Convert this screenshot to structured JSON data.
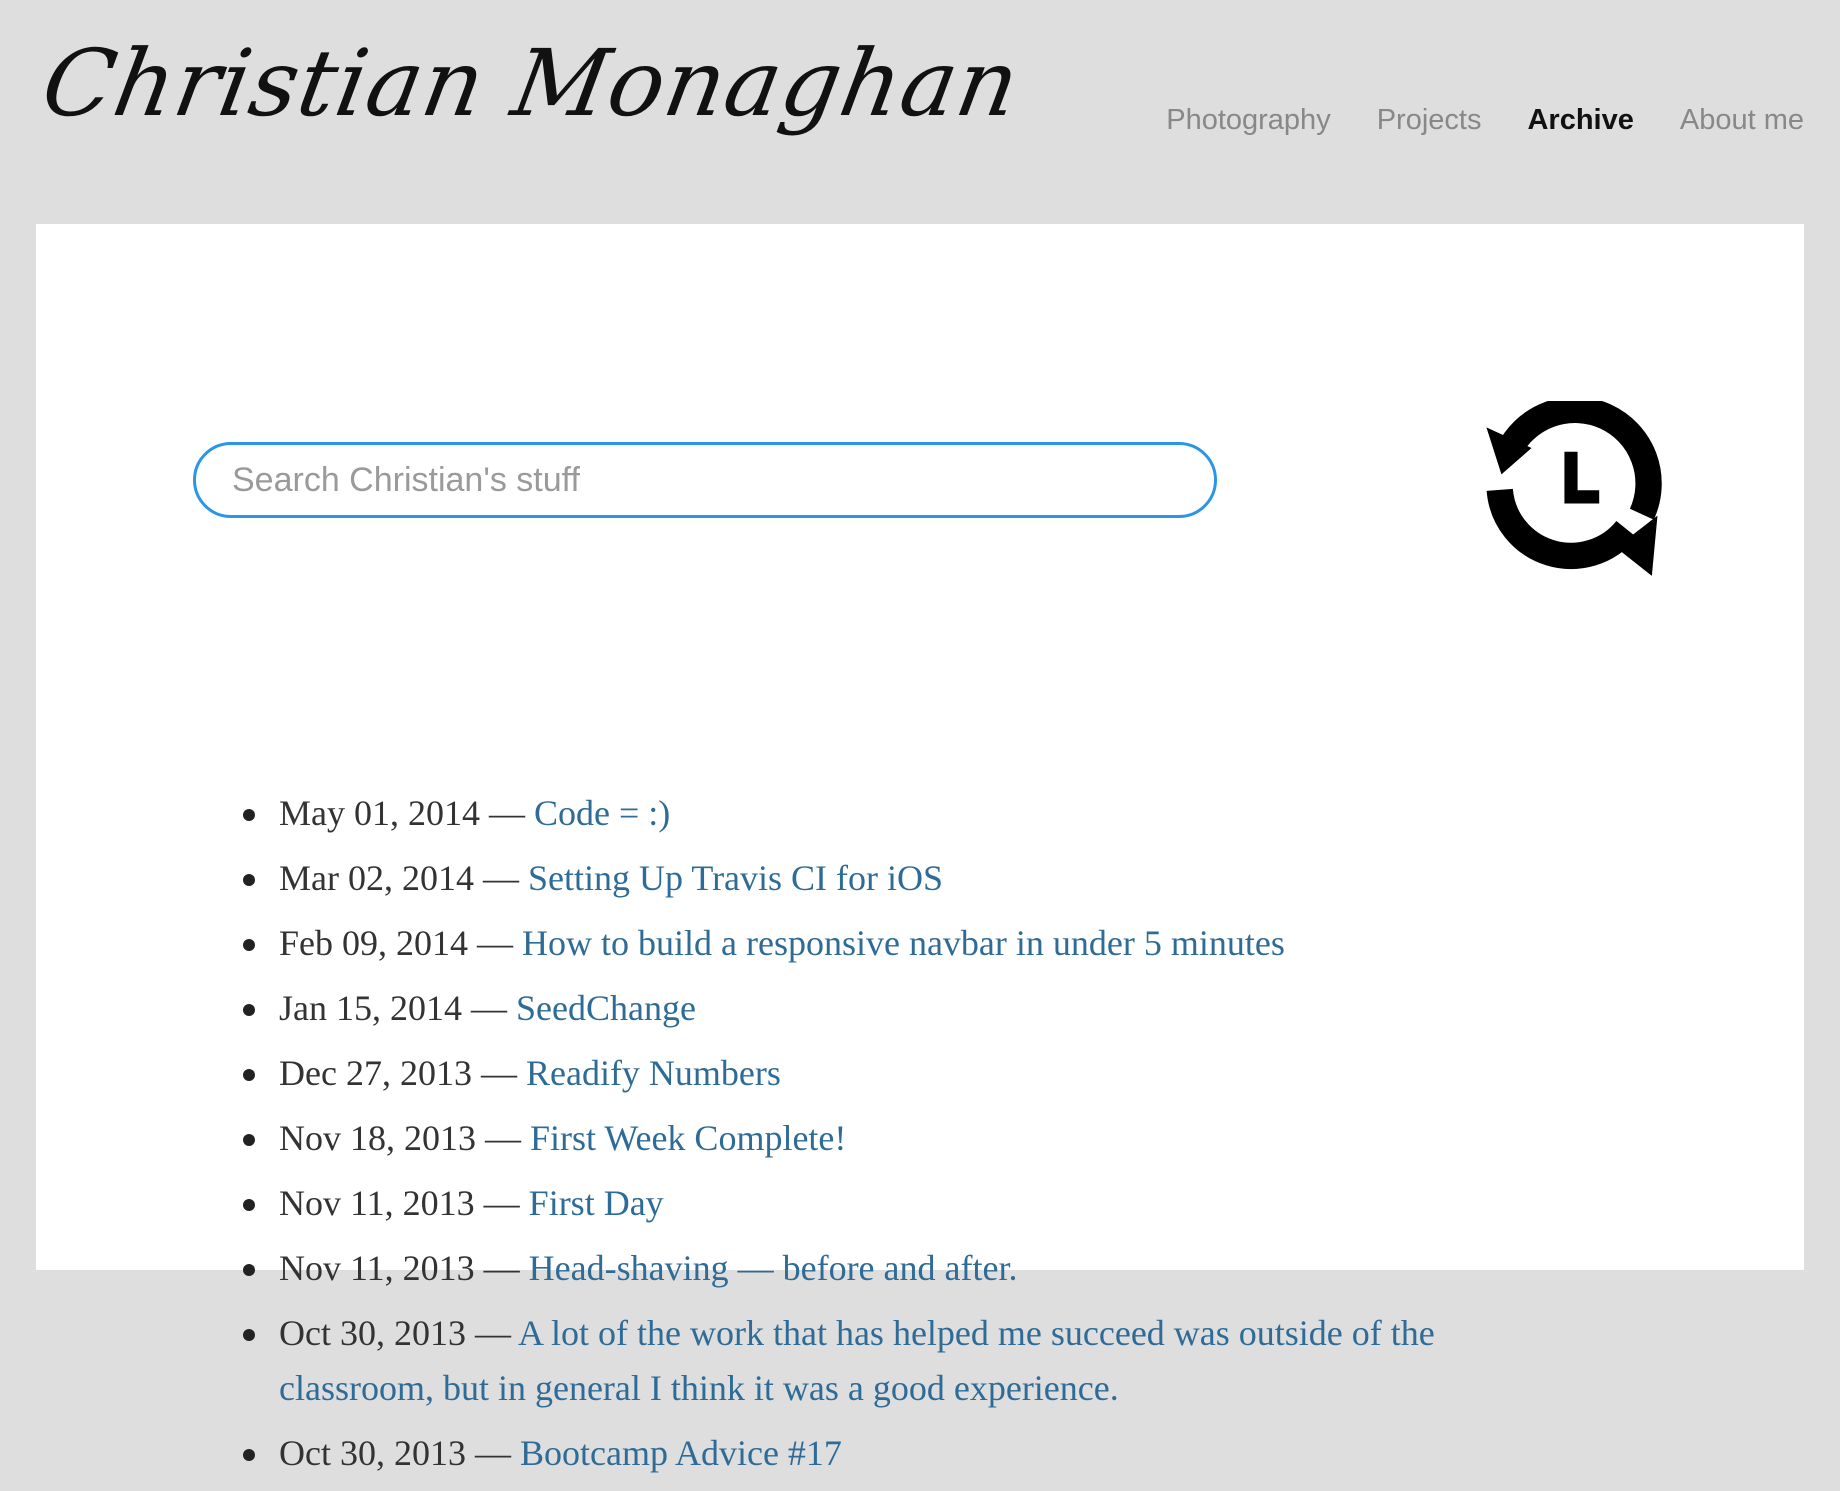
{
  "header": {
    "title": "Christian Monaghan",
    "nav": [
      {
        "label": "Photography",
        "active": false
      },
      {
        "label": "Projects",
        "active": false
      },
      {
        "label": "Archive",
        "active": true
      },
      {
        "label": "About me",
        "active": false
      }
    ]
  },
  "search": {
    "placeholder": "Search Christian's stuff",
    "value": ""
  },
  "icons": {
    "history": "history-clock-icon"
  },
  "colors": {
    "page_background": "#dedede",
    "content_background": "#ffffff",
    "link": "#2e6c97",
    "search_border": "#2b95e8",
    "nav_inactive": "#888888",
    "nav_active": "#111111"
  },
  "posts": [
    {
      "date": "May 01, 2014",
      "sep": " — ",
      "title": "Code = :)"
    },
    {
      "date": "Mar 02, 2014",
      "sep": " — ",
      "title": "Setting Up Travis CI for iOS"
    },
    {
      "date": "Feb 09, 2014",
      "sep": " — ",
      "title": "How to build a responsive navbar in under 5 minutes"
    },
    {
      "date": "Jan 15, 2014",
      "sep": " — ",
      "title": "SeedChange"
    },
    {
      "date": "Dec 27, 2013",
      "sep": " — ",
      "title": "Readify Numbers"
    },
    {
      "date": "Nov 18, 2013",
      "sep": " — ",
      "title": "First Week Complete!"
    },
    {
      "date": "Nov 11, 2013",
      "sep": " — ",
      "title": "First Day"
    },
    {
      "date": "Nov 11, 2013",
      "sep": " — ",
      "title": "Head-shaving — before and after."
    },
    {
      "date": "Oct 30, 2013",
      "sep": " — ",
      "title": "A lot of the work that has helped me succeed was outside of the classroom, but in general I think it was a good experience."
    },
    {
      "date": "Oct 30, 2013",
      "sep": " — ",
      "title": "Bootcamp Advice #17"
    }
  ]
}
